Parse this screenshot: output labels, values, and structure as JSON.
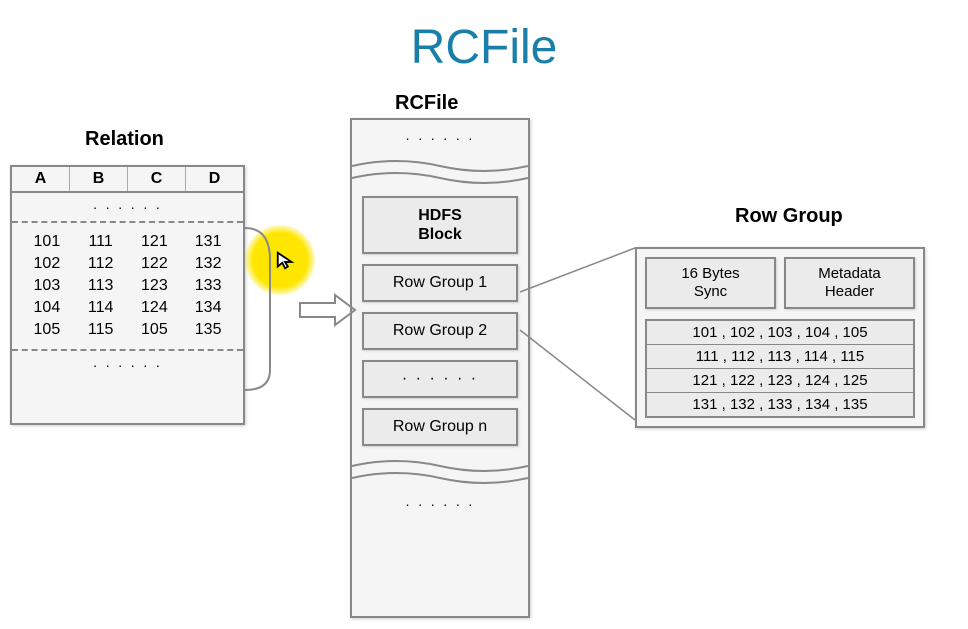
{
  "title": "RCFile",
  "relation": {
    "label": "Relation",
    "headers": [
      "A",
      "B",
      "C",
      "D"
    ],
    "dots": "· · · · · ·",
    "rows": [
      [
        "101",
        "111",
        "121",
        "131"
      ],
      [
        "102",
        "112",
        "122",
        "132"
      ],
      [
        "103",
        "113",
        "123",
        "133"
      ],
      [
        "104",
        "114",
        "124",
        "134"
      ],
      [
        "105",
        "115",
        "105",
        "135"
      ]
    ]
  },
  "rcfile": {
    "label": "RCFile",
    "top_dots": "· · · · · ·",
    "hdfs_block": "HDFS\nBlock",
    "row_groups": [
      "Row Group 1",
      "Row Group 2",
      "· · · · · ·",
      "Row Group n"
    ],
    "bottom_dots": "· · · · · ·"
  },
  "rowgroup": {
    "label": "Row Group",
    "sync": "16 Bytes\nSync",
    "metadata": "Metadata\nHeader",
    "data_rows": [
      "101 , 102 , 103 , 104 , 105",
      "111 , 112 , 113 , 114 , 115",
      "121 , 122 , 123 , 124 , 125",
      "131 , 132 , 133 , 134 , 135"
    ]
  }
}
